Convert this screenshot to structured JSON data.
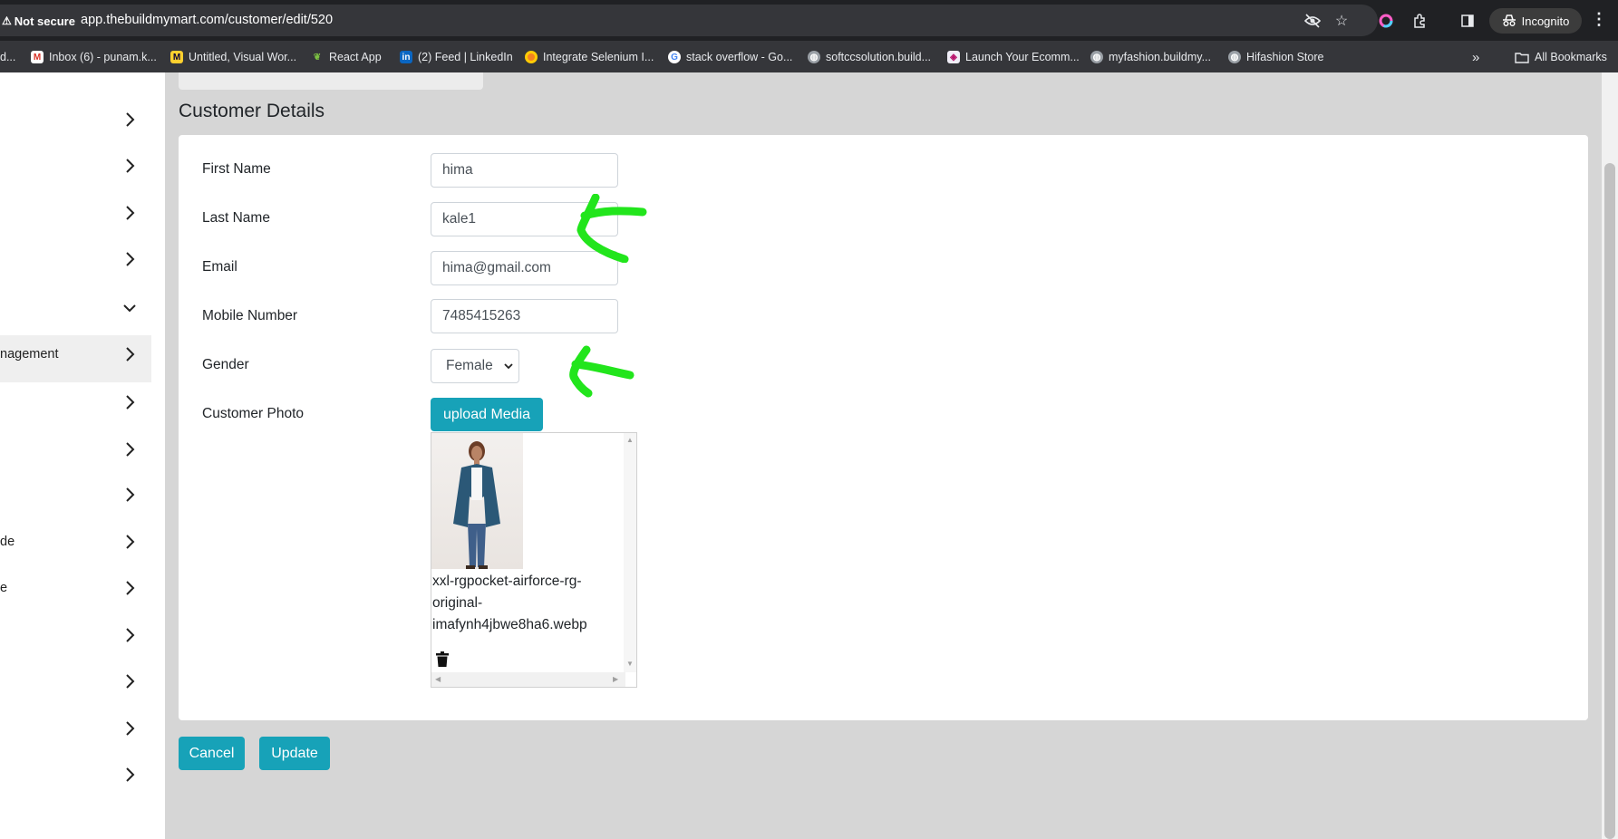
{
  "browser": {
    "security_label": "Not secure",
    "url": "app.thebuildmymart.com/customer/edit/520",
    "profile_label": "Incognito",
    "bookmarks": [
      {
        "label": "d...",
        "icon": "bookmark-icon"
      },
      {
        "label": "Inbox (6) - punam.k...",
        "icon": "gmail-icon"
      },
      {
        "label": "Untitled, Visual Wor...",
        "icon": "miro-icon"
      },
      {
        "label": "React App",
        "icon": "plant-icon"
      },
      {
        "label": "(2) Feed | LinkedIn",
        "icon": "linkedin-icon"
      },
      {
        "label": "Integrate Selenium I...",
        "icon": "browserstack-icon"
      },
      {
        "label": "stack overflow - Go...",
        "icon": "google-icon"
      },
      {
        "label": "softccsolution.build...",
        "icon": "globe-icon"
      },
      {
        "label": "Launch Your Ecomm...",
        "icon": "shop-icon"
      },
      {
        "label": "myfashion.buildmy...",
        "icon": "globe-icon"
      },
      {
        "label": "Hifashion Store",
        "icon": "globe-icon"
      }
    ],
    "overflow_label": "»",
    "all_bookmarks_label": "All Bookmarks"
  },
  "sidebar": {
    "items": [
      {
        "label": "",
        "state": "collapsed"
      },
      {
        "label": "",
        "state": "collapsed"
      },
      {
        "label": "",
        "state": "collapsed"
      },
      {
        "label": "",
        "state": "collapsed"
      },
      {
        "label": "",
        "state": "expanded"
      },
      {
        "label": "nagement",
        "state": "collapsed"
      },
      {
        "label": "",
        "state": "collapsed"
      },
      {
        "label": "",
        "state": "collapsed"
      },
      {
        "label": "",
        "state": "collapsed"
      },
      {
        "label": "de",
        "state": "collapsed"
      },
      {
        "label": "e",
        "state": "collapsed"
      },
      {
        "label": "",
        "state": "collapsed"
      },
      {
        "label": "",
        "state": "collapsed"
      },
      {
        "label": "",
        "state": "collapsed"
      },
      {
        "label": "",
        "state": "collapsed"
      }
    ]
  },
  "page": {
    "title": "Customer Details"
  },
  "form": {
    "first_name": {
      "label": "First Name",
      "value": "hima"
    },
    "last_name": {
      "label": "Last Name",
      "value": "kale1"
    },
    "email": {
      "label": "Email",
      "value": "hima@gmail.com"
    },
    "mobile": {
      "label": "Mobile Number",
      "value": "7485415263"
    },
    "gender": {
      "label": "Gender",
      "value": "Female"
    },
    "photo": {
      "label": "Customer Photo",
      "upload_label": "upload Media",
      "file_name": "xxl-rgpocket-airforce-rg-original-imafynh4jbwe8ha6.webp"
    }
  },
  "actions": {
    "cancel_label": "Cancel",
    "update_label": "Update"
  },
  "colors": {
    "accent": "#17a2b8",
    "annotation": "#22e51c",
    "page_bg": "#d6d6d6"
  }
}
